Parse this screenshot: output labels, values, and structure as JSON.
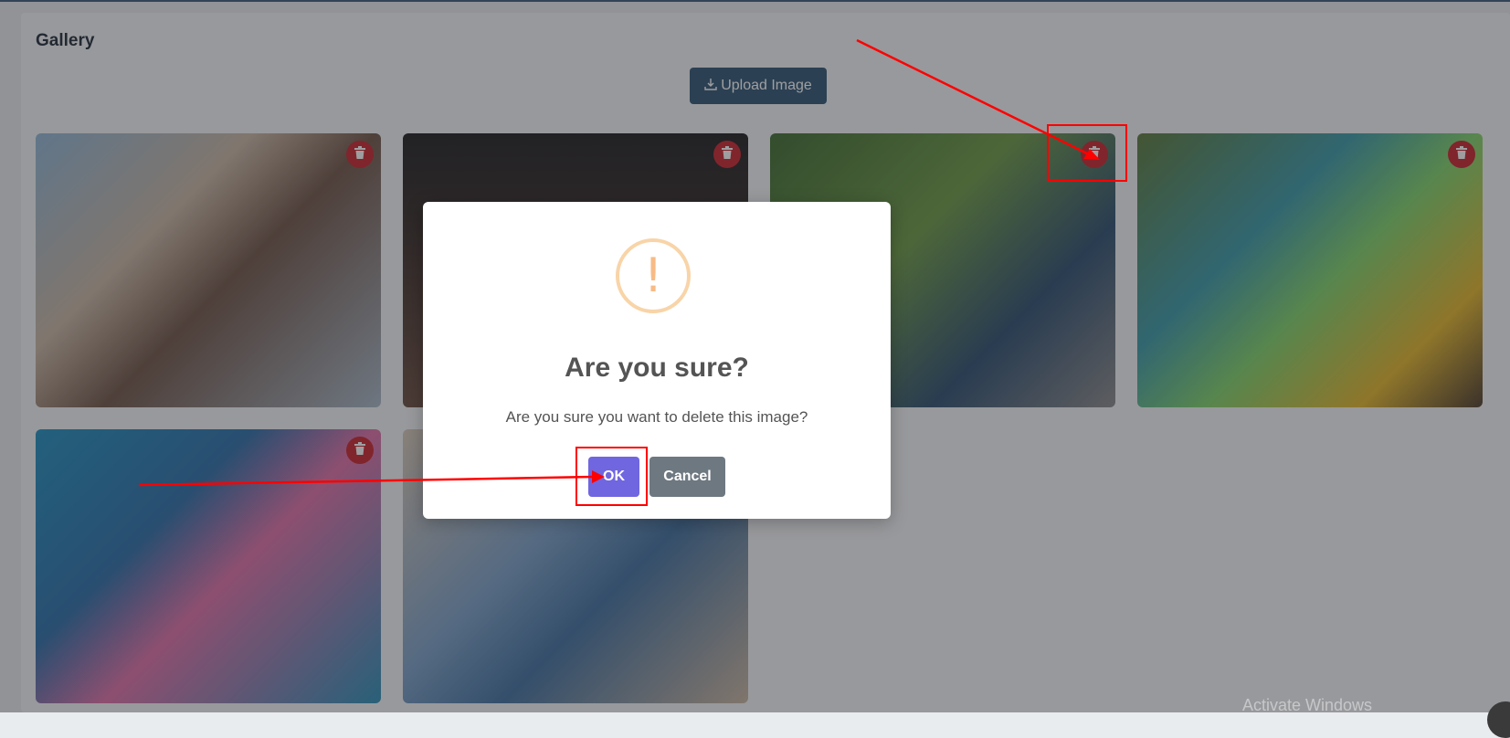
{
  "gallery": {
    "title": "Gallery",
    "upload_label": "Upload Image",
    "images": [
      {
        "name": "girl-red-sunglasses"
      },
      {
        "name": "boy-dark-portrait"
      },
      {
        "name": "child-rope-course"
      },
      {
        "name": "three-kids-sitting"
      },
      {
        "name": "kids-swimming-pool"
      },
      {
        "name": "kids-lying-together"
      }
    ]
  },
  "dialog": {
    "title": "Are you sure?",
    "message": "Are you sure you want to delete this image?",
    "ok_label": "OK",
    "cancel_label": "Cancel",
    "icon_glyph": "!"
  },
  "system": {
    "watermark": "Activate Windows"
  },
  "colors": {
    "primary": "#2f5473",
    "delete": "#c8232c",
    "ok": "#7066e0",
    "cancel": "#6e7881",
    "warning": "#f8bb86",
    "annotation": "#ff0000"
  }
}
